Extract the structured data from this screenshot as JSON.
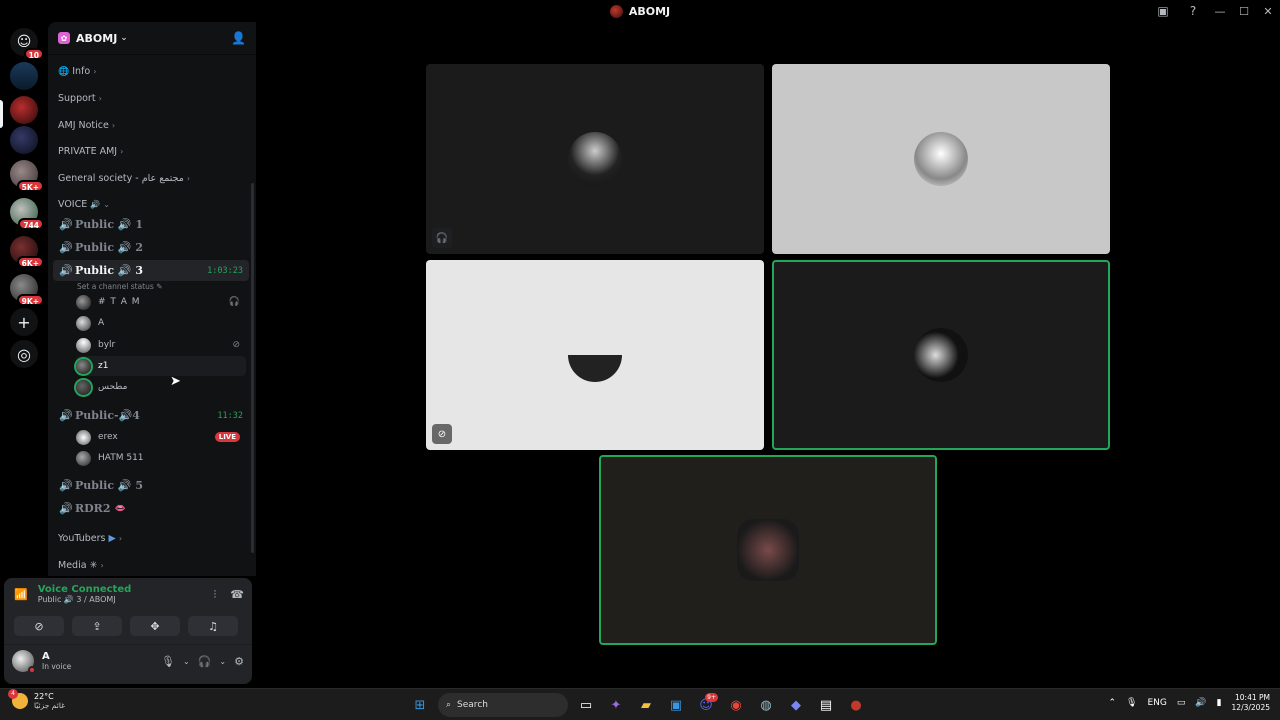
{
  "window": {
    "title": "ABOMJ"
  },
  "rail": {
    "home_badge": "10",
    "servers": [
      {
        "name": "west",
        "badge": ""
      },
      {
        "name": "abomj",
        "badge": ""
      },
      {
        "name": "server-3",
        "badge": ""
      },
      {
        "name": "server-4",
        "badge": "5K+"
      },
      {
        "name": "server-5",
        "badge": "744"
      },
      {
        "name": "server-6",
        "badge": "6K+"
      },
      {
        "name": "server-7",
        "badge": "9K+"
      }
    ]
  },
  "server": {
    "name": "ABOMJ"
  },
  "categories": {
    "info": "Info",
    "support": "Support",
    "amj_notice": "AMJ Notice",
    "private_amj": "PRIVATE AMJ",
    "general": "General society - مجتمع عام",
    "voice": "VOICE",
    "youtubers": "YouTubers",
    "media": "Media"
  },
  "voice_channels": {
    "public1": "Public 🔊 1",
    "public2": "Public 🔊 2",
    "public3": "Public 🔊 3",
    "public3_timer": "1:03:23",
    "public3_status": "Set a channel status",
    "public4": "Public-🔊4",
    "public4_timer": "11:32",
    "public5": "Public 🔊 5",
    "rdr2": "RDR2"
  },
  "members_public3": [
    {
      "name": "# T A M"
    },
    {
      "name": "A"
    },
    {
      "name": "bylr"
    },
    {
      "name": "z1"
    },
    {
      "name": "مطحس"
    }
  ],
  "members_public4": [
    {
      "name": "erex",
      "badge": "LIVE"
    },
    {
      "name": "HATM 511"
    }
  ],
  "voice_panel": {
    "title": "Voice Connected",
    "subtitle": "Public 🔊 3 / ABOMJ"
  },
  "user": {
    "name": "A",
    "status": "In voice"
  },
  "taskbar": {
    "temp": "22°C",
    "weather_desc": "غائم جزئيًا",
    "weather_badge": "4",
    "search": "Search",
    "discord_badge": "9+",
    "lang": "ENG",
    "time": "10:41 PM",
    "date": "12/3/2025"
  },
  "colors": {
    "accent_green": "#23a55a",
    "danger_red": "#da373c",
    "bg": "#000000"
  }
}
